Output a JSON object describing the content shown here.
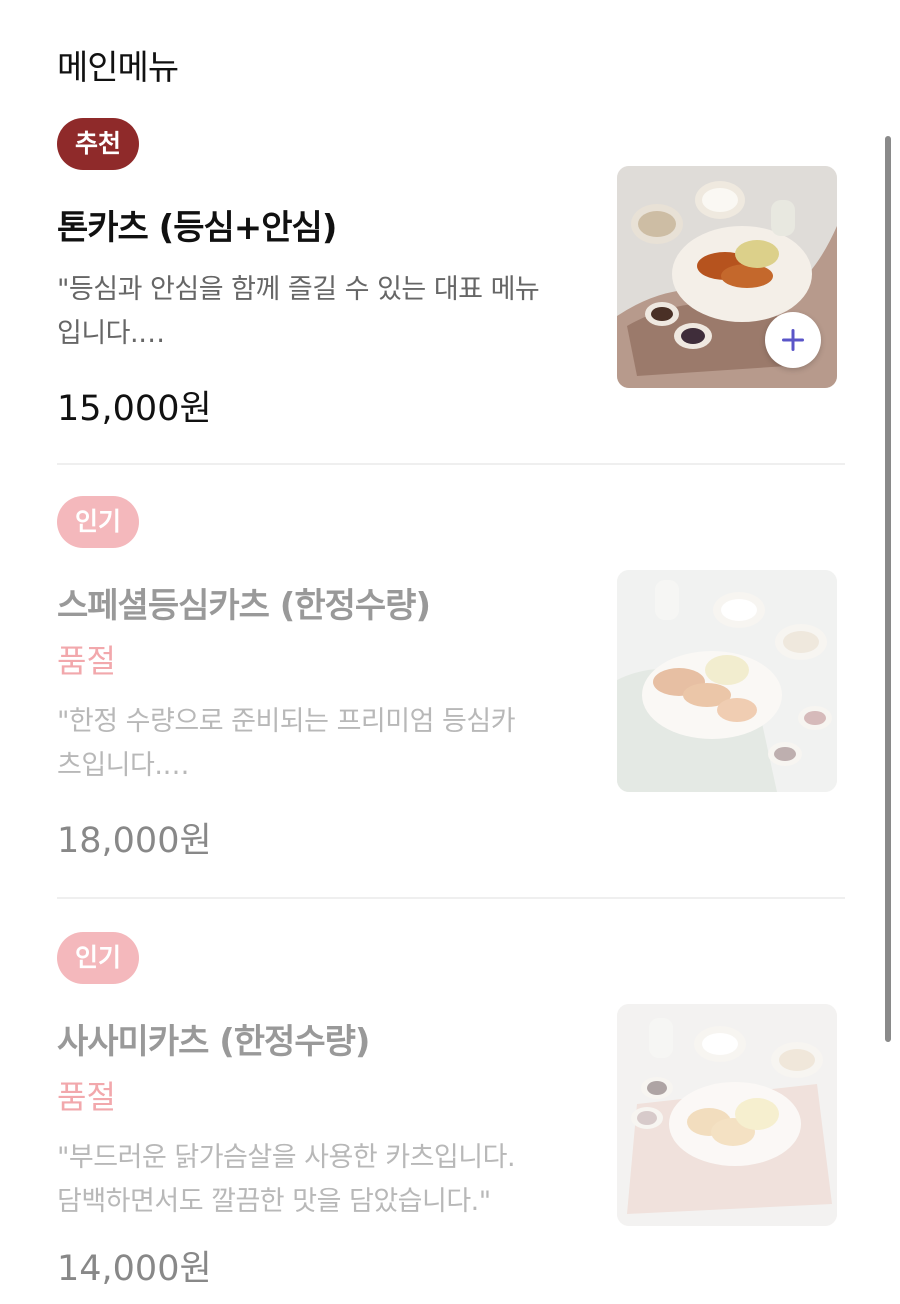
{
  "section": {
    "title": "메인메뉴"
  },
  "items": [
    {
      "badge": "추천",
      "name": "톤카츠 (등심+안심)",
      "status": "",
      "desc_line1": "\"등심과 안심을 함께 즐길 수 있는 대표 메뉴",
      "desc_line2": "입니다.…",
      "price": "15,000원",
      "image_icon": "tonkatsu-set-photo",
      "add_icon": "plus-icon"
    },
    {
      "badge": "인기",
      "name": "스페셜등심카츠 (한정수량)",
      "status": "품절",
      "desc_line1": "\"한정 수량으로 준비되는 프리미엄 등심카",
      "desc_line2": "츠입니다.…",
      "price": "18,000원",
      "image_icon": "special-loin-katsu-photo"
    },
    {
      "badge": "인기",
      "name": "사사미카츠 (한정수량)",
      "status": "품절",
      "desc_line1": "\"부드러운 닭가슴살을 사용한 카츠입니다.",
      "desc_line2": "담백하면서도 깔끔한 맛을 담았습니다.\"",
      "price": "14,000원",
      "image_icon": "chicken-katsu-photo"
    }
  ],
  "colors": {
    "recommend_badge": "#8f2a2a",
    "popular_badge": "#f4b8bc",
    "soldout_text": "#f2a8ac",
    "add_icon": "#5a55c8"
  }
}
